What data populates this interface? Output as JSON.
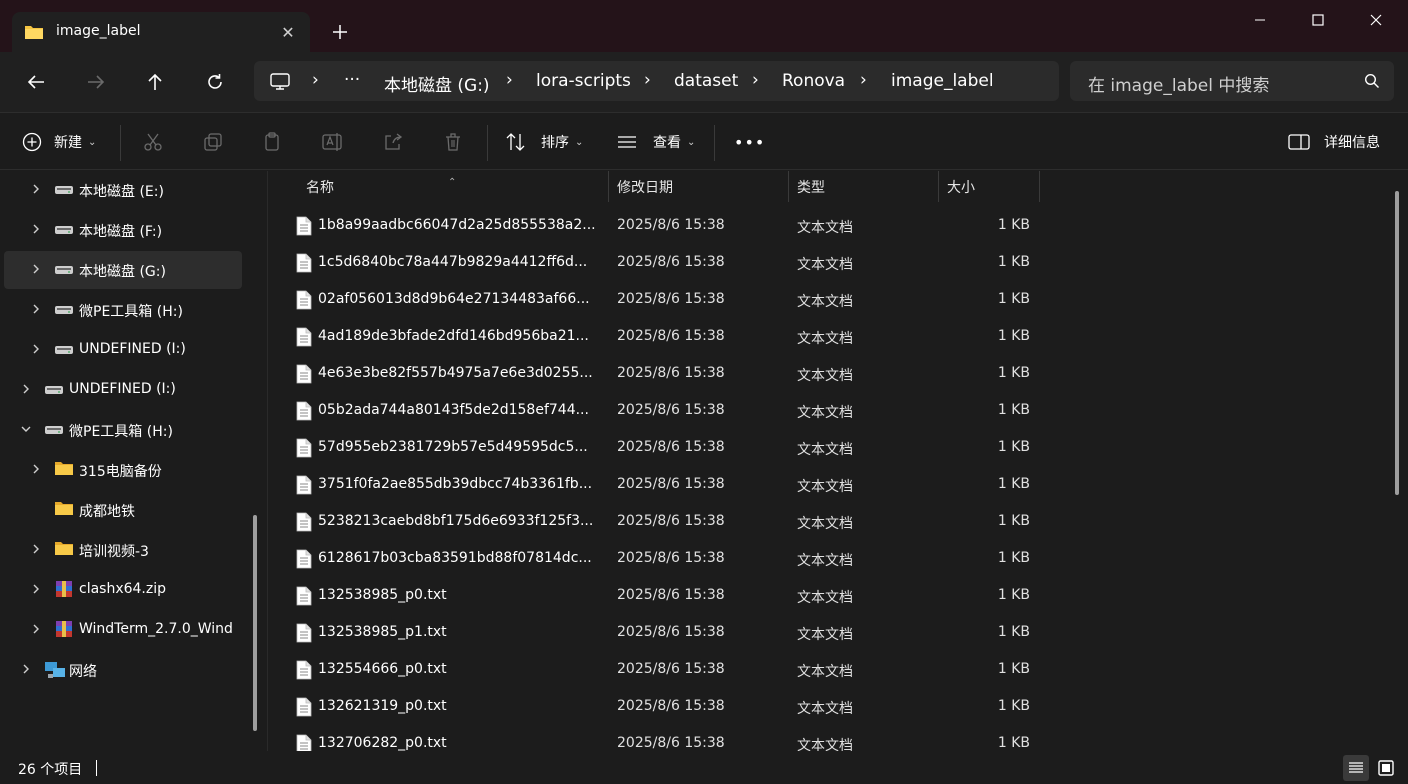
{
  "tab": {
    "title": "image_label",
    "close_glyph": "✕",
    "new_glyph": "+"
  },
  "window": {
    "minimize": "—",
    "maximize": "☐",
    "close": "✕"
  },
  "address": {
    "breadcrumbs": [
      "本地磁盘 (G:)",
      "lora-scripts",
      "dataset",
      "Ronova",
      "image_label"
    ],
    "more": "···",
    "sep": "›"
  },
  "search": {
    "placeholder": "在 image_label 中搜索"
  },
  "toolbar": {
    "new_label": "新建",
    "sort_label": "排序",
    "view_label": "查看",
    "more": "•••",
    "details_label": "详细信息"
  },
  "sidebar": {
    "items": [
      {
        "label": "本地磁盘 (E:)",
        "icon": "drive-icon",
        "expandable": true,
        "selected": false
      },
      {
        "label": "本地磁盘 (F:)",
        "icon": "drive-icon",
        "expandable": true,
        "selected": false
      },
      {
        "label": "本地磁盘 (G:)",
        "icon": "drive-icon",
        "expandable": true,
        "selected": true
      },
      {
        "label": "微PE工具箱 (H:)",
        "icon": "drive-icon",
        "expandable": true,
        "selected": false
      },
      {
        "label": "UNDEFINED (I:)",
        "icon": "drive-icon",
        "expandable": true,
        "selected": false
      },
      {
        "label": "UNDEFINED (I:)",
        "icon": "drive-icon",
        "expandable": true,
        "selected": false
      },
      {
        "label": "微PE工具箱 (H:)",
        "icon": "drive-icon",
        "expandable": true,
        "expanded": true,
        "selected": false
      },
      {
        "label": "315电脑备份",
        "icon": "folder-icon",
        "expandable": true,
        "selected": false
      },
      {
        "label": "成都地铁",
        "icon": "folder-icon",
        "expandable": false,
        "selected": false
      },
      {
        "label": "培训视频-3",
        "icon": "folder-icon",
        "expandable": true,
        "selected": false
      },
      {
        "label": "clashx64.zip",
        "icon": "archive-icon",
        "expandable": true,
        "selected": false
      },
      {
        "label": "WindTerm_2.7.0_Wind",
        "icon": "archive-icon",
        "expandable": true,
        "selected": false
      },
      {
        "label": "网络",
        "icon": "network-icon",
        "expandable": true,
        "selected": false
      }
    ]
  },
  "columns": {
    "name": "名称",
    "modified": "修改日期",
    "type": "类型",
    "size": "大小"
  },
  "files": [
    {
      "name": "1b8a99aadbc66047d2a25d855538a2...",
      "modified": "2025/8/6 15:38",
      "type": "文本文档",
      "size": "1 KB"
    },
    {
      "name": "1c5d6840bc78a447b9829a4412ff6d...",
      "modified": "2025/8/6 15:38",
      "type": "文本文档",
      "size": "1 KB"
    },
    {
      "name": "02af056013d8d9b64e27134483af66...",
      "modified": "2025/8/6 15:38",
      "type": "文本文档",
      "size": "1 KB"
    },
    {
      "name": "4ad189de3bfade2dfd146bd956ba21...",
      "modified": "2025/8/6 15:38",
      "type": "文本文档",
      "size": "1 KB"
    },
    {
      "name": "4e63e3be82f557b4975a7e6e3d0255...",
      "modified": "2025/8/6 15:38",
      "type": "文本文档",
      "size": "1 KB"
    },
    {
      "name": "05b2ada744a80143f5de2d158ef744...",
      "modified": "2025/8/6 15:38",
      "type": "文本文档",
      "size": "1 KB"
    },
    {
      "name": "57d955eb2381729b57e5d49595dc5...",
      "modified": "2025/8/6 15:38",
      "type": "文本文档",
      "size": "1 KB"
    },
    {
      "name": "3751f0fa2ae855db39dbcc74b3361fb...",
      "modified": "2025/8/6 15:38",
      "type": "文本文档",
      "size": "1 KB"
    },
    {
      "name": "5238213caebd8bf175d6e6933f125f3...",
      "modified": "2025/8/6 15:38",
      "type": "文本文档",
      "size": "1 KB"
    },
    {
      "name": "6128617b03cba83591bd88f07814dc...",
      "modified": "2025/8/6 15:38",
      "type": "文本文档",
      "size": "1 KB"
    },
    {
      "name": "132538985_p0.txt",
      "modified": "2025/8/6 15:38",
      "type": "文本文档",
      "size": "1 KB"
    },
    {
      "name": "132538985_p1.txt",
      "modified": "2025/8/6 15:38",
      "type": "文本文档",
      "size": "1 KB"
    },
    {
      "name": "132554666_p0.txt",
      "modified": "2025/8/6 15:38",
      "type": "文本文档",
      "size": "1 KB"
    },
    {
      "name": "132621319_p0.txt",
      "modified": "2025/8/6 15:38",
      "type": "文本文档",
      "size": "1 KB"
    },
    {
      "name": "132706282_p0.txt",
      "modified": "2025/8/6 15:38",
      "type": "文本文档",
      "size": "1 KB"
    }
  ],
  "status": {
    "item_count": "26 个项目"
  },
  "colors": {
    "titlebar": "#241319",
    "window": "#202020",
    "accent_folder": "#f5c542",
    "selected": "#2d2d2d"
  }
}
